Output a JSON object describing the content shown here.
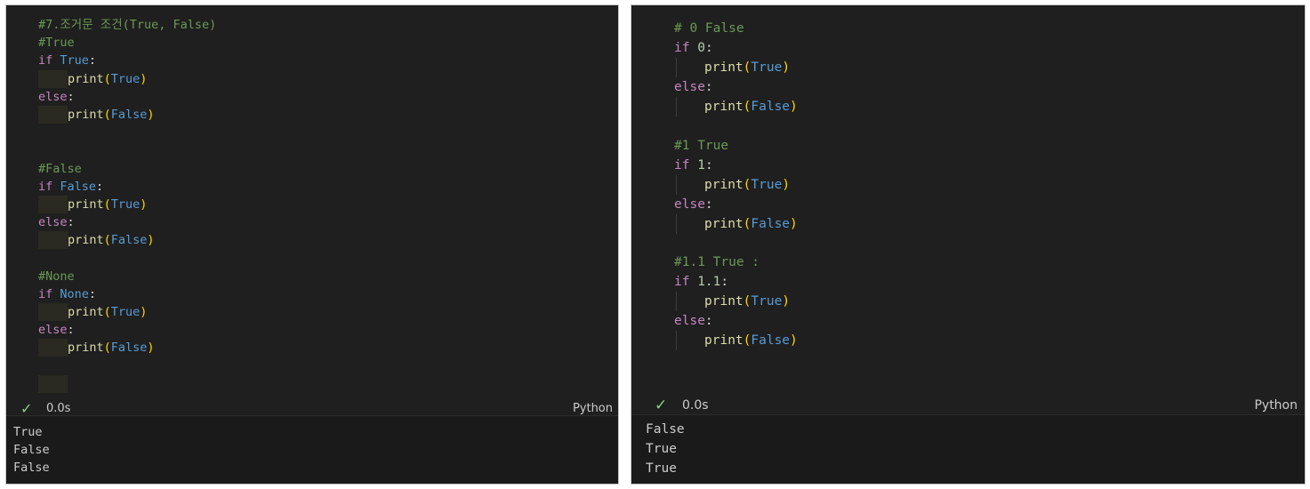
{
  "left_cell": {
    "code": {
      "title_comment": "#7.조거문 조건(True, False)",
      "true_comment": "#True",
      "false_comment": "#False",
      "none_comment": "#None",
      "kw_if": "if",
      "kw_else": "else",
      "colon": ":",
      "fn_print": "print",
      "lparen": "(",
      "rparen": ")",
      "val_true": "True",
      "val_false": "False",
      "val_none": "None"
    },
    "status": {
      "check": "✓",
      "time": "0.0s",
      "language": "Python"
    },
    "output": [
      "True",
      "False",
      "False"
    ]
  },
  "right_cell": {
    "code": {
      "comment_0": "# 0 False",
      "comment_1": "#1 True",
      "comment_11": "#1.1 True :",
      "kw_if": "if",
      "kw_else": "else",
      "colon": ":",
      "num_0": "0",
      "num_1": "1",
      "num_11": "1.1",
      "fn_print": "print",
      "lparen": "(",
      "rparen": ")",
      "val_true": "True",
      "val_false": "False"
    },
    "status": {
      "check": "✓",
      "time": "0.0s",
      "language": "Python"
    },
    "output": [
      "False",
      "True",
      "True"
    ]
  }
}
